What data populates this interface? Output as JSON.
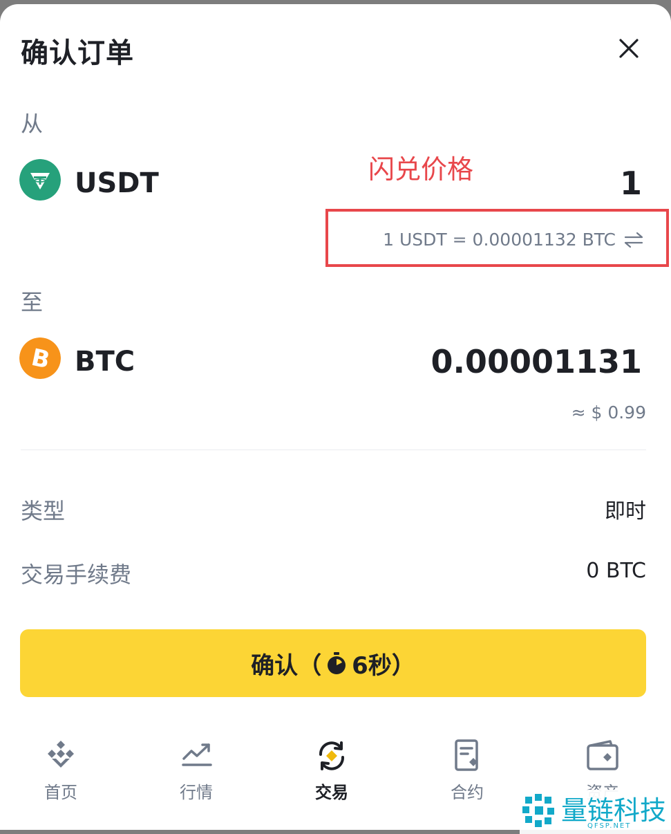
{
  "header": {
    "title": "确认订单"
  },
  "from": {
    "label": "从",
    "coin": "USDT",
    "amount": "1",
    "icon_color": "#26a17b",
    "icon": "tether-icon"
  },
  "annotation": {
    "text": "闪兑价格",
    "color": "#e8474b"
  },
  "rate": {
    "text": "1 USDT = 0.00001132 BTC"
  },
  "to": {
    "label": "至",
    "coin": "BTC",
    "amount": "0.00001131",
    "usd": "≈ $ 0.99",
    "icon_color": "#f7931a",
    "icon": "bitcoin-icon"
  },
  "details": {
    "type_label": "类型",
    "type_value": "即时",
    "fee_label": "交易手续费",
    "fee_value": "0 BTC"
  },
  "confirm": {
    "label": "确认（",
    "countdown": "6秒）",
    "color": "#fcd535"
  },
  "nav": {
    "items": [
      {
        "label": "首页",
        "icon": "home-icon"
      },
      {
        "label": "行情",
        "icon": "markets-icon"
      },
      {
        "label": "交易",
        "icon": "trade-icon",
        "active": true
      },
      {
        "label": "合约",
        "icon": "futures-icon"
      },
      {
        "label": "资产",
        "icon": "wallet-icon"
      }
    ]
  },
  "watermark": {
    "text": "量链科技",
    "sub": "QFSP.NET"
  }
}
